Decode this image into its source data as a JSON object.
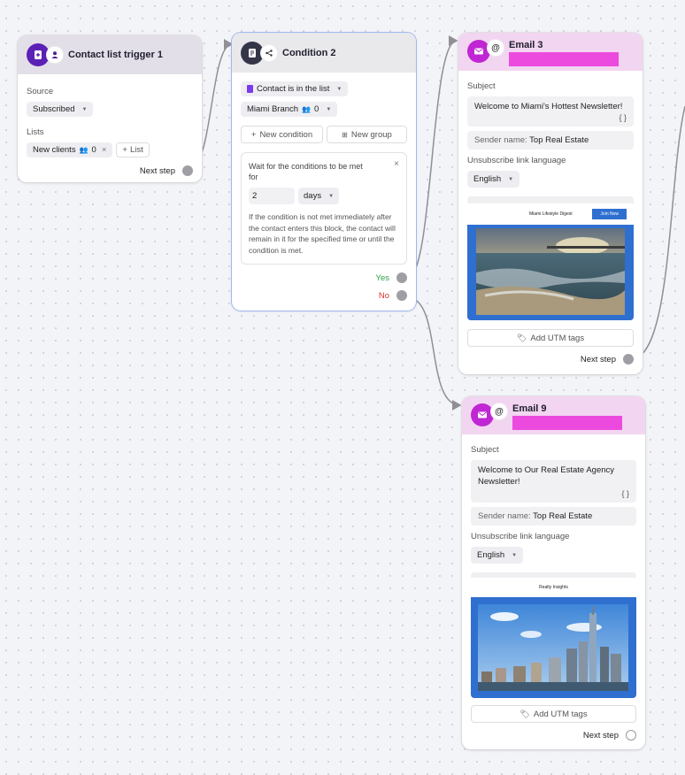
{
  "trigger": {
    "title": "Contact list trigger 1",
    "source_label": "Source",
    "source_value": "Subscribed",
    "lists_label": "Lists",
    "list_chip": "New clients",
    "list_chip_count": "0",
    "add_list": "List",
    "next_step": "Next step"
  },
  "condition": {
    "title": "Condition 2",
    "rule": "Contact is in the list",
    "branch": "Miami Branch",
    "branch_count": "0",
    "new_condition": "New condition",
    "new_group": "New group",
    "wait_text": "Wait for the conditions to be met for",
    "wait_value": "2",
    "wait_unit": "days",
    "info_text": "If the condition is not met immediately after the contact enters this block, the contact will remain in it for the specified time or until the condition is met.",
    "yes_label": "Yes",
    "no_label": "No"
  },
  "email3": {
    "title": "Email 3",
    "subject_label": "Subject",
    "subject_value": "Welcome to Miami's Hottest Newsletter!",
    "braces": "{ }",
    "sender_label": "Sender name:",
    "sender_value": "Top Real Estate",
    "unsub_label": "Unsubscribe link language",
    "language": "English",
    "preview_title": "Miami Lifestyle Digest",
    "preview_button": "Join Now",
    "add_utm": "Add UTM tags",
    "next_step": "Next step"
  },
  "email9": {
    "title": "Email 9",
    "subject_label": "Subject",
    "subject_value": "Welcome to Our Real Estate Agency Newsletter!",
    "braces": "{ }",
    "sender_label": "Sender name:",
    "sender_value": "Top Real Estate",
    "unsub_label": "Unsubscribe link language",
    "language": "English",
    "preview_title": "Realty Insights",
    "add_utm": "Add UTM tags",
    "next_step": "Next step"
  },
  "colors": {
    "trigger_header": "#e3dfe8",
    "condition_header": "#e9e9ec",
    "email_header": "#f2d5f0",
    "accent_purple": "#7c3aed",
    "email_icon": "#c026d3",
    "condition_border": "#9fb6f0",
    "yes": "#2e9e44",
    "no": "#d9342b",
    "preview_blue": "#2f6fd0"
  }
}
